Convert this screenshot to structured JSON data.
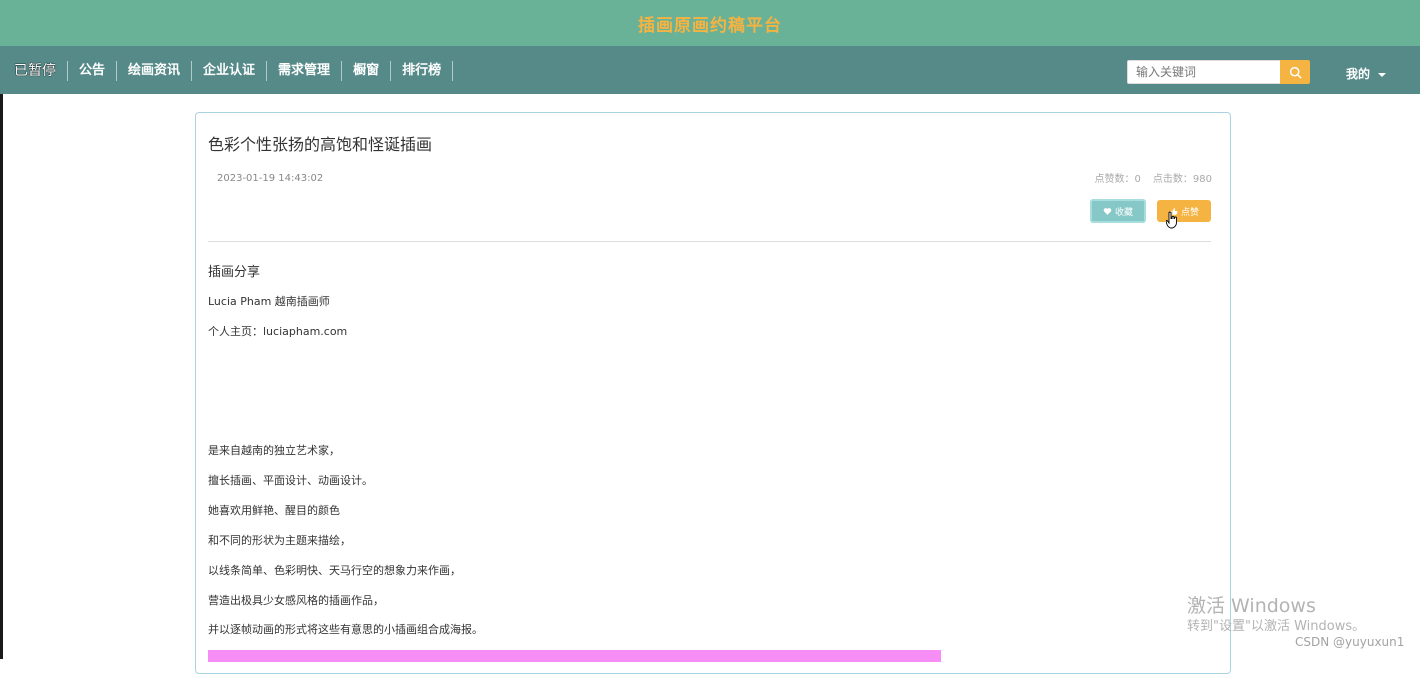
{
  "header": {
    "site_title": "插画原画约稿平台"
  },
  "nav": {
    "paused_label": "已暂停",
    "items": [
      "公告",
      "绘画资讯",
      "企业认证",
      "需求管理",
      "橱窗",
      "排行榜"
    ]
  },
  "search": {
    "placeholder": "输入关键词"
  },
  "user_menu": {
    "label": "我的"
  },
  "article": {
    "title": "色彩个性张扬的高饱和怪诞插画",
    "date": "2023-01-19 14:43:02",
    "likes_label": "点赞数：0",
    "clicks_label": "点击数：980",
    "fav_label": "收藏",
    "like_label": "点赞",
    "section_title": "插画分享",
    "author_line": " Lucia Pham 越南插画师",
    "homepage_line": "个人主页：luciapham.com",
    "paragraphs": [
      "是来自越南的独立艺术家，",
      "擅长插画、平面设计、动画设计。",
      "她喜欢用鲜艳、醒目的颜色",
      "和不同的形状为主题来描绘，",
      "以线条简单、色彩明快、天马行空的想象力来作画，",
      "营造出极具少女感风格的插画作品，",
      "并以逐帧动画的形式将这些有意思的小插画组合成海报。"
    ]
  },
  "watermark": {
    "line1": "激活 Windows",
    "line2": "转到\"设置\"以激活 Windows。",
    "csdn": "CSDN @yuyuxun1"
  },
  "colors": {
    "topbar": "#69b197",
    "navbar": "#558a88",
    "accent": "#f5b342",
    "fav_button": "#86c7c7",
    "pink_image": "#f78ef5"
  }
}
